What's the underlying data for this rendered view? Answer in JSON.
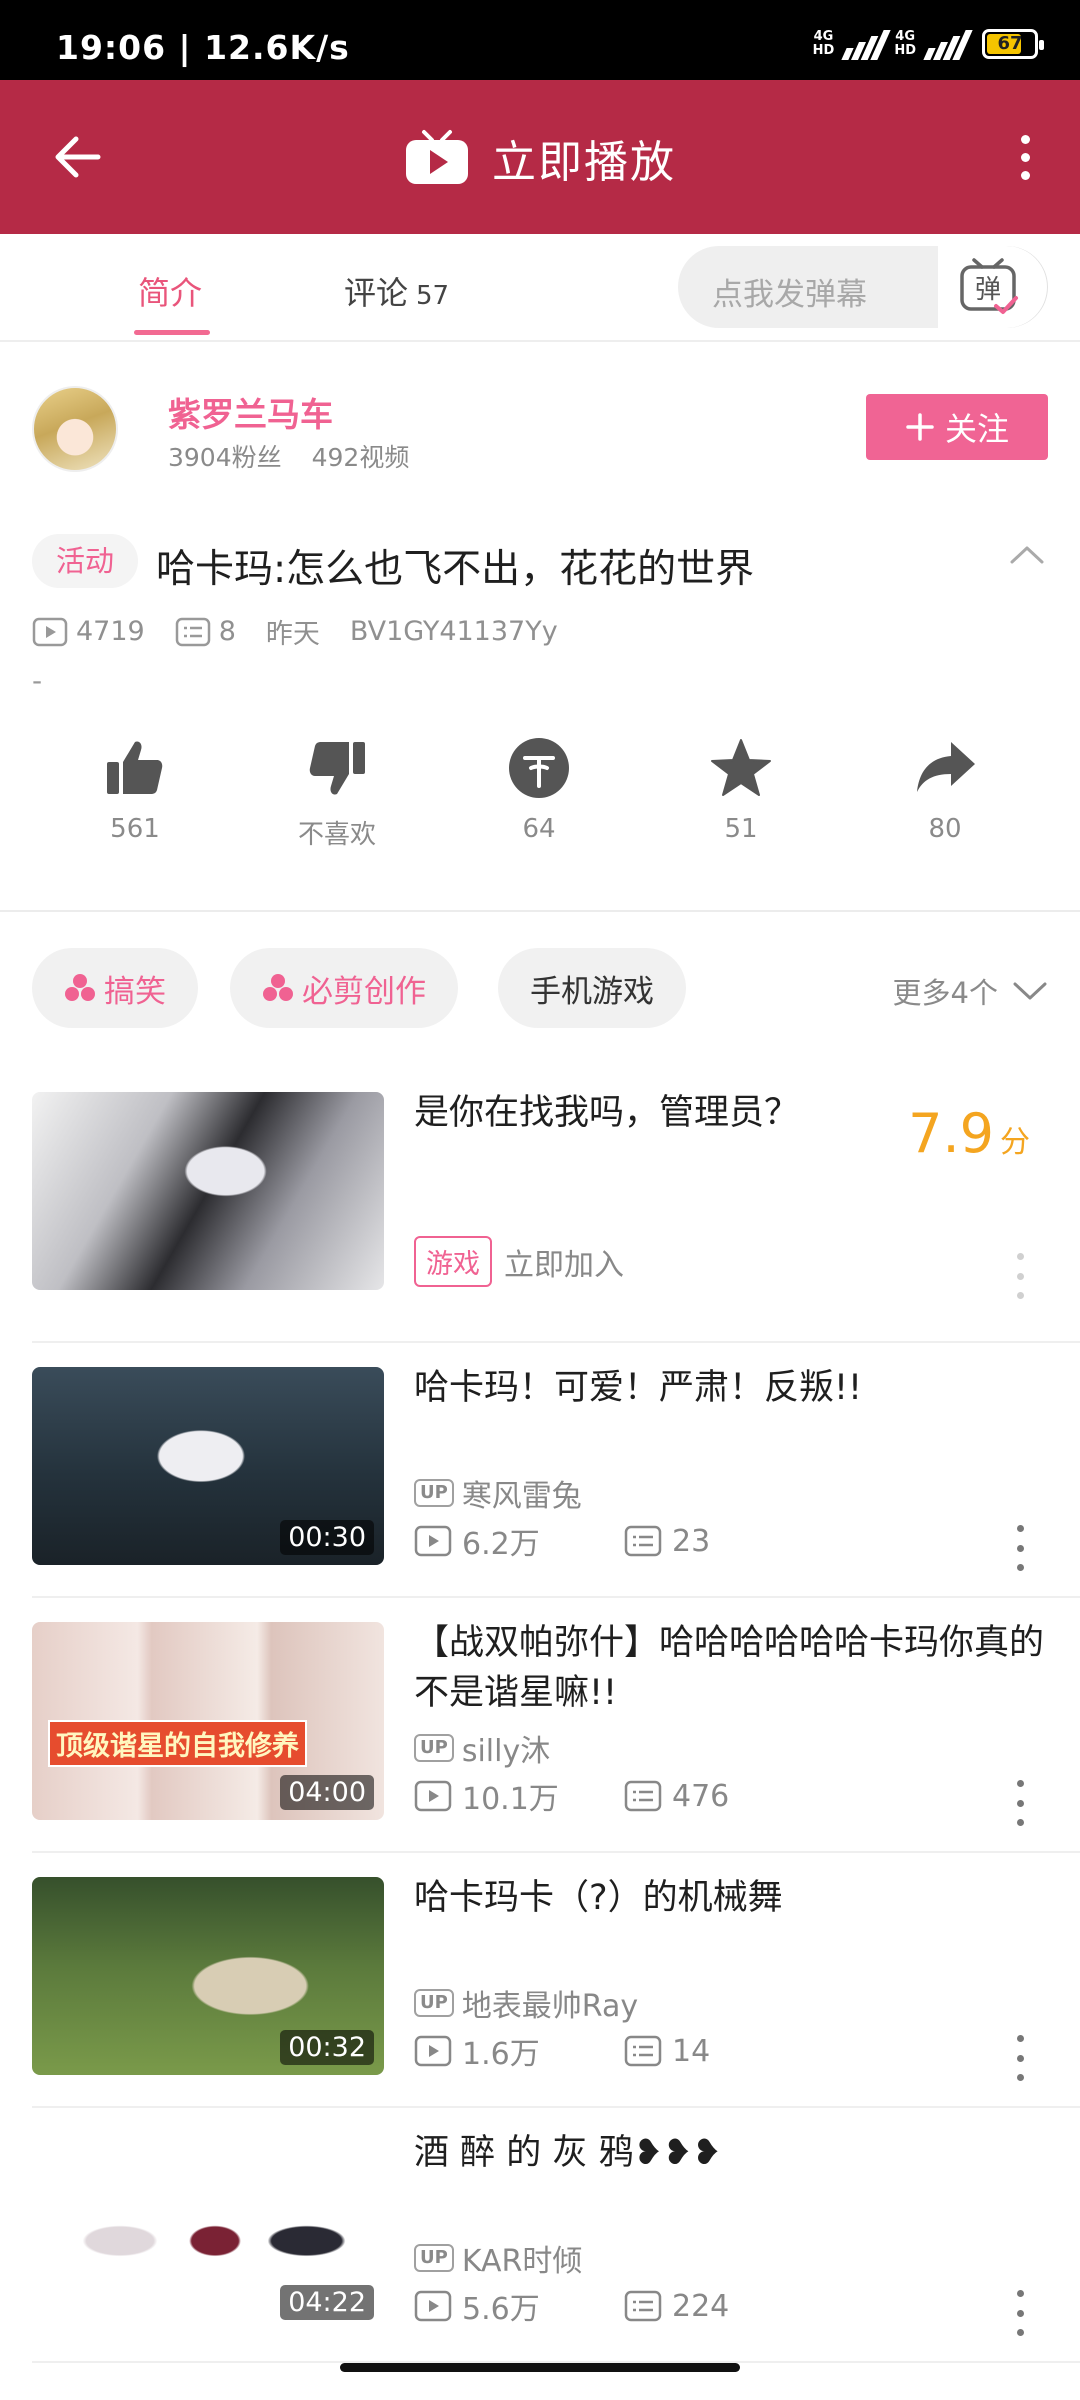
{
  "status": {
    "time": "19:06 | 12.6K/s",
    "net1": "4G",
    "net2": "4G",
    "hd": "HD",
    "battery": "67"
  },
  "header": {
    "title": "立即播放"
  },
  "tabs": {
    "intro": "简介",
    "comments": "评论",
    "comments_count": "57"
  },
  "danmaku": {
    "placeholder": "点我发弹幕",
    "button": "弹"
  },
  "uploader": {
    "name": "紫罗兰马车",
    "fans": "3904粉丝",
    "videos": "492视频",
    "follow": "关注"
  },
  "video": {
    "badge": "活动",
    "title": "哈卡玛:怎么也飞不出，花花的世界",
    "plays": "4719",
    "danmaku": "8",
    "time": "昨天",
    "bvid": "BV1GY41137Yy",
    "desc": "-"
  },
  "actions": {
    "like": "561",
    "dislike": "不喜欢",
    "coin": "64",
    "favorite": "51",
    "share": "80"
  },
  "tags": {
    "t1": "搞笑",
    "t2": "必剪创作",
    "t3": "手机游戏",
    "more": "更多4个"
  },
  "recommendations": [
    {
      "title": "是你在找我吗，管理员？",
      "score": "7.9",
      "score_unit": "分",
      "tag": "游戏",
      "action": "立即加入"
    },
    {
      "title": "哈卡玛！可爱！严肃！反叛!!",
      "up": "寒风雷兔",
      "plays": "6.2万",
      "danmaku": "23",
      "duration": "00:30"
    },
    {
      "title": "【战双帕弥什】哈哈哈哈哈哈卡玛你真的不是谐星嘛!!",
      "up": "silly沐",
      "plays": "10.1万",
      "danmaku": "476",
      "duration": "04:00",
      "thumb_caption": "顶级谐星的自我修养"
    },
    {
      "title": "哈卡玛卡（?）的机械舞",
      "up": "地表最帅Ray",
      "plays": "1.6万",
      "danmaku": "14",
      "duration": "00:32"
    },
    {
      "title": "酒 醉 的 灰 鸦❥❥❥",
      "up": "KAR时倾",
      "plays": "5.6万",
      "danmaku": "224",
      "duration": "04:22"
    }
  ],
  "labels": {
    "up": "UP"
  },
  "colors": {
    "header_bg": "#b52a46",
    "accent_pink": "#f06292",
    "score_orange": "#f4a520"
  },
  "icons": [
    "back-arrow-icon",
    "tv-icon",
    "more-vertical-icon",
    "danmaku-icon",
    "plus-icon",
    "chevron-up-icon",
    "play-count-icon",
    "danmaku-count-icon",
    "thumb-up-icon",
    "thumb-down-icon",
    "coin-icon",
    "star-icon",
    "share-icon",
    "tag-flower-icon",
    "chevron-down-icon"
  ]
}
